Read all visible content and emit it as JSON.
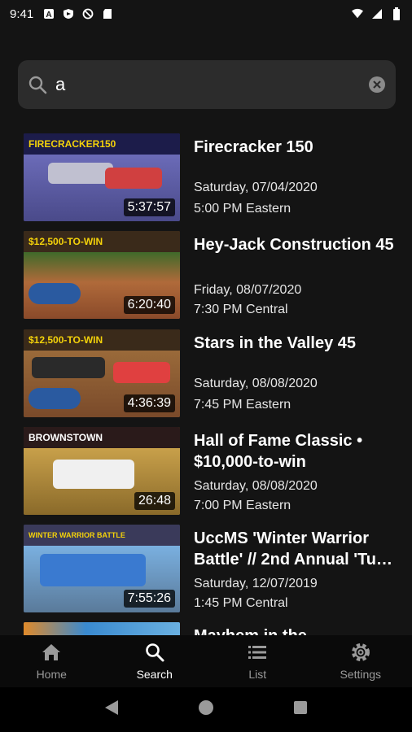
{
  "status_bar": {
    "time": "9:41",
    "left_icons": [
      "a-icon",
      "shield-icon",
      "no-sync-icon",
      "sd-card-icon"
    ],
    "right_icons": [
      "wifi-icon",
      "signal-icon",
      "battery-icon"
    ]
  },
  "search": {
    "value": "a",
    "icon": "search-icon",
    "clear_icon": "clear-icon"
  },
  "results": [
    {
      "title": "Firecracker 150",
      "date": "Saturday, 07/04/2020",
      "time": "5:00 PM Eastern",
      "duration": "5:37:57",
      "banner": "FIRECRACKER150",
      "banner_color": "#f4d20a"
    },
    {
      "title": "Hey-Jack Construction 45",
      "date": "Friday, 08/07/2020",
      "time": "7:30 PM Central",
      "duration": "6:20:40",
      "banner": "$12,500-TO-WIN",
      "banner_color": "#f4d20a"
    },
    {
      "title": "Stars in the Valley 45",
      "date": "Saturday, 08/08/2020",
      "time": "7:45 PM Eastern",
      "duration": "4:36:39",
      "banner": "$12,500-TO-WIN",
      "banner_color": "#f4d20a"
    },
    {
      "title": "Hall of Fame Classic • $10,000-to-win",
      "date": "Saturday, 08/08/2020",
      "time": "7:00 PM Eastern",
      "duration": "26:48",
      "banner": "BROWNSTOWN",
      "banner_color": "#ffffff"
    },
    {
      "title": "UccMS 'Winter Warrior Battle' // 2nd Annual 'Tu…",
      "date": "Saturday, 12/07/2019",
      "time": "1:45 PM Central",
      "duration": "7:55:26",
      "banner": "WINTER WARRIOR BATTLE",
      "banner_color": "#f4d20a"
    },
    {
      "title": "Mayhem in the",
      "date": "",
      "time": "",
      "duration": "",
      "banner": "",
      "banner_color": "#f4d20a"
    }
  ],
  "bottom_nav": [
    {
      "label": "Home",
      "icon": "home-icon",
      "active": false
    },
    {
      "label": "Search",
      "icon": "search-icon",
      "active": true
    },
    {
      "label": "List",
      "icon": "list-icon",
      "active": false
    },
    {
      "label": "Settings",
      "icon": "gear-icon",
      "active": false
    }
  ],
  "system_nav": [
    "back-icon",
    "home-circle-icon",
    "recents-icon"
  ]
}
